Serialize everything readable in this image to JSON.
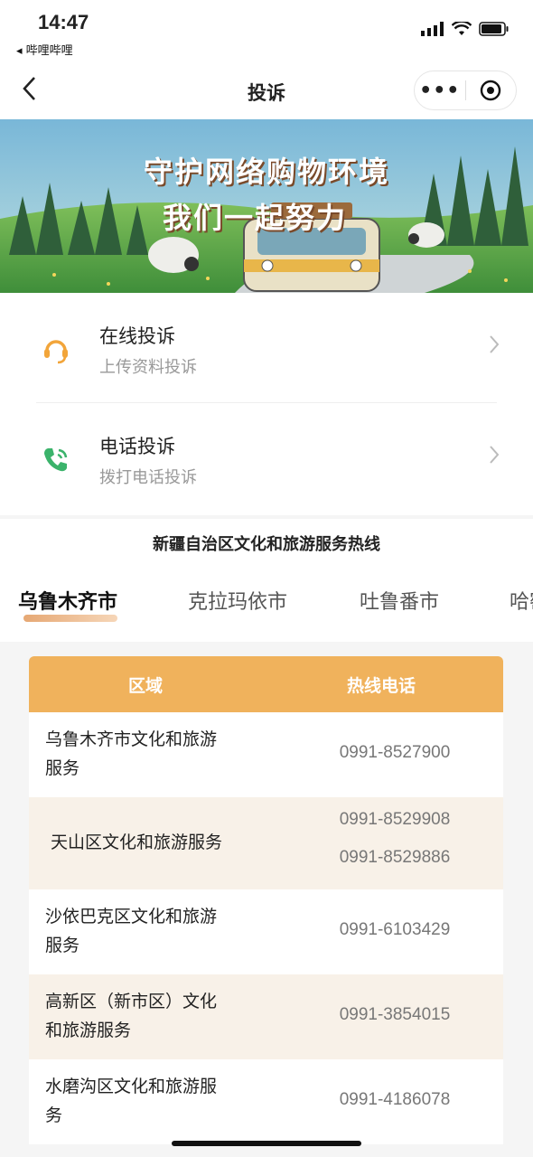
{
  "status": {
    "time": "14:47",
    "back_app": "◂ 哔哩哔哩"
  },
  "nav": {
    "title": "投诉",
    "more": "•••"
  },
  "banner": {
    "line1": "守护网络购物环境",
    "line2": "我们一起努力"
  },
  "menu": [
    {
      "title": "在线投诉",
      "subtitle": "上传资料投诉",
      "icon": "headset-icon",
      "color": "#f2a53a"
    },
    {
      "title": "电话投诉",
      "subtitle": "拨打电话投诉",
      "icon": "phone-icon",
      "color": "#3bb36b"
    }
  ],
  "hotline_title": "新疆自治区文化和旅游服务热线",
  "tabs": [
    "乌鲁木齐市",
    "克拉玛依市",
    "吐鲁番市",
    "哈密市"
  ],
  "active_tab": 0,
  "table": {
    "headers": {
      "area": "区域",
      "phone": "热线电话"
    },
    "rows": [
      {
        "area_l1": "乌鲁木齐市文化和旅游",
        "area_l2": "服务",
        "phones": [
          "0991-8527900"
        ]
      },
      {
        "area_l1": "天山区文化和旅游服务",
        "area_l2": "",
        "phones": [
          "0991-8529908",
          "0991-8529886"
        ]
      },
      {
        "area_l1": "沙依巴克区文化和旅游",
        "area_l2": "服务",
        "phones": [
          "0991-6103429"
        ]
      },
      {
        "area_l1": "高新区（新市区）文化",
        "area_l2": "和旅游服务",
        "phones": [
          "0991-3854015"
        ]
      },
      {
        "area_l1": "水磨沟区文化和旅游服",
        "area_l2": "务",
        "phones": [
          "0991-4186078"
        ]
      }
    ]
  },
  "colors": {
    "accent": "#f0b25c",
    "alt_row": "#f8f1e8"
  }
}
